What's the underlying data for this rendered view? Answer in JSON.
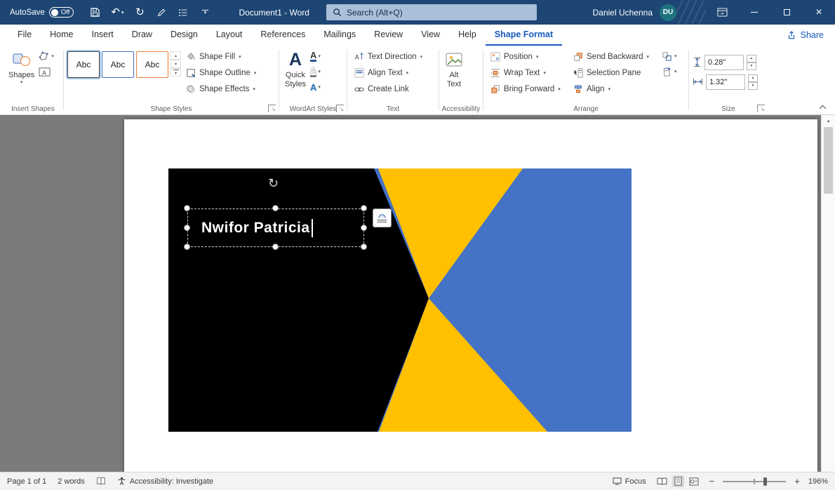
{
  "title_bar": {
    "autosave_label": "AutoSave",
    "autosave_state": "Off",
    "document_title": "Document1 - Word",
    "search_placeholder": "Search (Alt+Q)",
    "user_name": "Daniel Uchenna",
    "user_initials": "DU"
  },
  "tabs": {
    "items": [
      {
        "label": "File"
      },
      {
        "label": "Home"
      },
      {
        "label": "Insert"
      },
      {
        "label": "Draw"
      },
      {
        "label": "Design"
      },
      {
        "label": "Layout"
      },
      {
        "label": "References"
      },
      {
        "label": "Mailings"
      },
      {
        "label": "Review"
      },
      {
        "label": "View"
      },
      {
        "label": "Help"
      },
      {
        "label": "Shape Format"
      }
    ],
    "active": "Shape Format",
    "share_label": "Share"
  },
  "ribbon": {
    "insert_shapes": {
      "label": "Insert Shapes",
      "shapes_button": "Shapes"
    },
    "shape_styles": {
      "label": "Shape Styles",
      "presets": [
        {
          "label": "Abc"
        },
        {
          "label": "Abc"
        },
        {
          "label": "Abc"
        }
      ],
      "shape_fill": "Shape Fill",
      "shape_outline": "Shape Outline",
      "shape_effects": "Shape Effects"
    },
    "wordart_styles": {
      "label": "WordArt Styles",
      "quick_line1": "Quick",
      "quick_line2": "Styles"
    },
    "text_group": {
      "label": "Text",
      "text_direction": "Text Direction",
      "align_text": "Align Text",
      "create_link": "Create Link"
    },
    "accessibility_group": {
      "label": "Accessibility",
      "alt_line1": "Alt",
      "alt_line2": "Text"
    },
    "arrange": {
      "label": "Arrange",
      "position": "Position",
      "wrap_text": "Wrap Text",
      "bring_forward": "Bring Forward",
      "send_backward": "Send Backward",
      "selection_pane": "Selection Pane",
      "align": "Align"
    },
    "size": {
      "label": "Size",
      "height_value": "0.28\"",
      "width_value": "1.32\""
    }
  },
  "icons": {
    "dropdown": "▾",
    "up": "▴",
    "undo": "↶",
    "redo": "↻",
    "rotate_handle": "↻",
    "close": "×",
    "launcher": "↘",
    "letter_a": "A",
    "minus": "−",
    "plus": "+"
  },
  "canvas": {
    "wordart_text": "Nwifor Patricia",
    "card_colors": {
      "background": "#000000",
      "blue": "#4472c4",
      "yellow": "#ffc000"
    }
  },
  "status_bar": {
    "page_info": "Page 1 of 1",
    "word_count": "2 words",
    "accessibility_status": "Accessibility: Investigate",
    "focus_label": "Focus",
    "zoom_level": "196%"
  }
}
